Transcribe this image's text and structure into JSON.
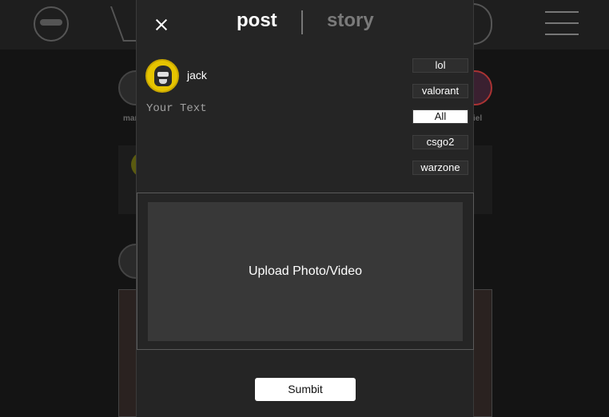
{
  "background": {
    "stories": [
      {
        "name": "mar"
      },
      {
        "name": "iel"
      }
    ]
  },
  "modal": {
    "tabs": [
      {
        "label": "post",
        "active": true
      },
      {
        "label": "story",
        "active": false
      }
    ],
    "user": {
      "name": "jack"
    },
    "text_input": {
      "placeholder": "Your Text",
      "value": ""
    },
    "categories": [
      {
        "label": "lol",
        "selected": false
      },
      {
        "label": "valorant",
        "selected": false
      },
      {
        "label": "All",
        "selected": true
      },
      {
        "label": "csgo2",
        "selected": false
      },
      {
        "label": "warzone",
        "selected": false
      }
    ],
    "upload": {
      "label": "Upload Photo/Video"
    },
    "submit_label": "Sumbit"
  },
  "colors": {
    "backdrop": "#141414",
    "modal_bg": "#252525",
    "upload_bg": "#383838",
    "active_tab": "#ffffff",
    "inactive_tab": "#7a7a7a",
    "avatar_ring": "#e6c400"
  }
}
